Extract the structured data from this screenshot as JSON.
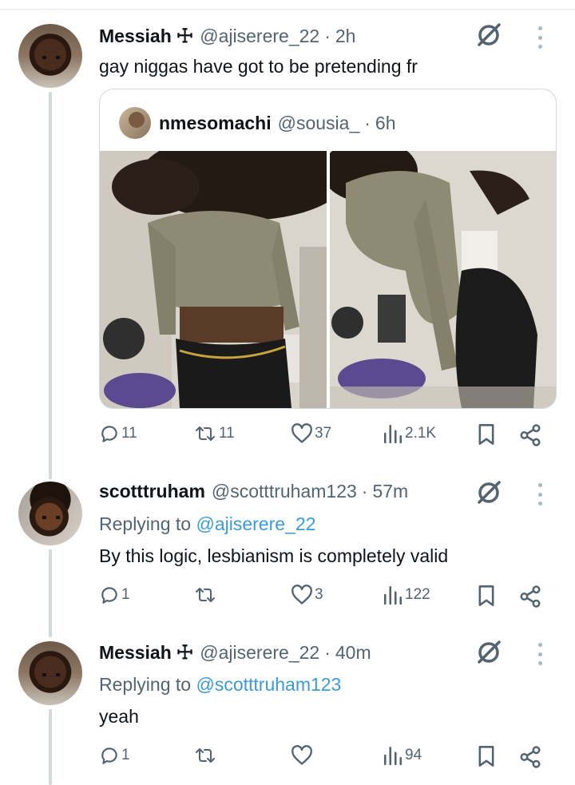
{
  "tweets": [
    {
      "name": "Messiah",
      "badge": "☩",
      "handle": "@ajiserere_22",
      "time": "2h",
      "text": "gay niggas have got to be pretending fr",
      "quote": {
        "name": "nmesomachi",
        "handle": "@sousia_",
        "time": "6h"
      },
      "stats": {
        "replies": "11",
        "retweets": "11",
        "likes": "37",
        "views": "2.1K"
      }
    },
    {
      "name": "scotttruham",
      "handle": "@scotttruham123",
      "time": "57m",
      "replying_prefix": "Replying to ",
      "replying_to": "@ajiserere_22",
      "text": "By this logic, lesbianism is completely valid",
      "stats": {
        "replies": "1",
        "retweets": "",
        "likes": "3",
        "views": "122"
      }
    },
    {
      "name": "Messiah",
      "badge": "☩",
      "handle": "@ajiserere_22",
      "time": "40m",
      "replying_prefix": "Replying to ",
      "replying_to": "@scotttruham123",
      "text": "yeah",
      "stats": {
        "replies": "1",
        "retweets": "",
        "likes": "",
        "views": "94"
      }
    }
  ],
  "separator": "·",
  "icons": [
    "reply-icon",
    "retweet-icon",
    "like-icon",
    "views-icon",
    "bookmark-icon",
    "share-icon",
    "grok-icon",
    "more-icon"
  ]
}
